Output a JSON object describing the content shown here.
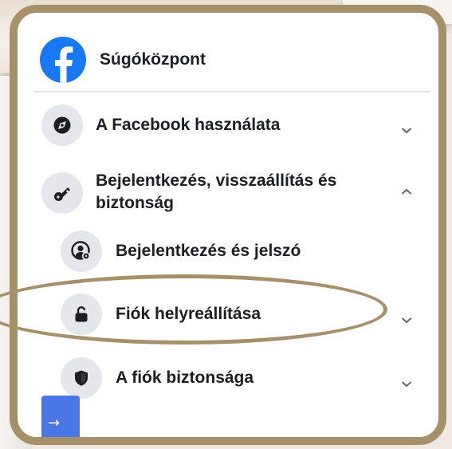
{
  "header": {
    "title": "Súgóközpont",
    "logo_icon": "facebook-logo-icon"
  },
  "items": [
    {
      "label": "A Facebook használata",
      "icon": "compass-icon",
      "chevron": "chevron-down-icon"
    },
    {
      "label_line1": "Bejelentkezés, visszaállítás és",
      "label_line2": "biztonság",
      "icon": "key-icon",
      "chevron": "chevron-up-icon"
    },
    {
      "label": "Bejelentkezés és jelszó",
      "icon": "user-settings-icon"
    },
    {
      "label": "Fiók helyreállítása",
      "icon": "unlock-icon",
      "chevron": "chevron-down-icon"
    },
    {
      "label": "A fiók biztonsága",
      "icon": "shield-icon",
      "chevron": "chevron-down-icon"
    }
  ],
  "colors": {
    "accent": "#1877f2",
    "frame": "#a6906a",
    "icon_bg": "#e4e6eb",
    "text": "#1c1e21"
  },
  "tab": {
    "arrow": "→"
  }
}
